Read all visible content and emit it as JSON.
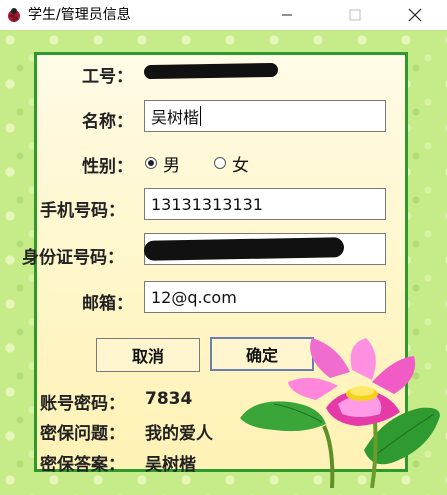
{
  "window": {
    "title": "学生/管理员信息"
  },
  "form": {
    "id_label": "工号：",
    "name_label": "名称：",
    "name_value": "吴树楷",
    "gender_label": "性别：",
    "gender_male": "男",
    "gender_female": "女",
    "phone_label": "手机号码：",
    "phone_value": "13131313131",
    "idcard_label": "身份证号码：",
    "email_label": "邮箱：",
    "email_value": "12@q.com"
  },
  "buttons": {
    "cancel": "取消",
    "confirm": "确定"
  },
  "info": {
    "password_label": "账号密码：",
    "password_value": "7834",
    "question_label": "密保问题：",
    "question_value": "我的爱人",
    "answer_label": "密保答案：",
    "answer_value": "吴树楷"
  },
  "colors": {
    "panel_border": "#2f9a2b",
    "background_green": "#c6ec8a",
    "panel_fill": "#fff8d3"
  }
}
